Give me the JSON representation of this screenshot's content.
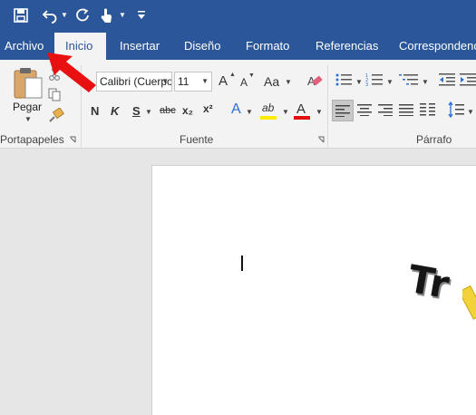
{
  "tabs": [
    {
      "label": "Archivo"
    },
    {
      "label": "Inicio"
    },
    {
      "label": "Insertar"
    },
    {
      "label": "Diseño"
    },
    {
      "label": "Formato"
    },
    {
      "label": "Referencias"
    },
    {
      "label": "Correspondencia"
    }
  ],
  "clipboard": {
    "paste_label": "Pegar",
    "group_label": "Portapapeles"
  },
  "font": {
    "family_value": "Calibri (Cuerpo)",
    "size_value": "11",
    "grow_label": "A",
    "shrink_label": "A",
    "case_label": "Aa",
    "bold": "N",
    "italic": "K",
    "underline": "S",
    "strike": "abc",
    "subscript": "x₂",
    "superscript": "x²",
    "effects_label": "A",
    "highlight_label": "ab",
    "color_label": "A",
    "group_label": "Fuente"
  },
  "paragraph": {
    "group_label": "Párrafo"
  },
  "document": {
    "wordart_text": "Tr"
  },
  "colors": {
    "brand": "#2b579a",
    "arrow": "#e81010",
    "font_color": "#e01010",
    "highlight": "#ffeb00"
  }
}
